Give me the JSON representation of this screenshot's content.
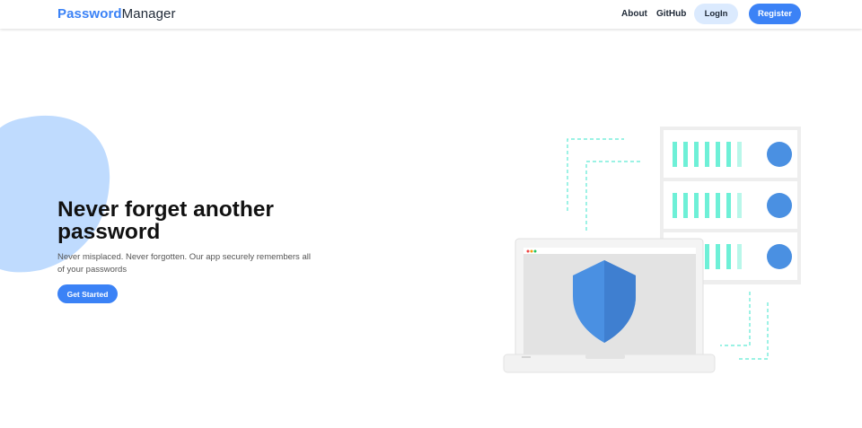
{
  "nav": {
    "brand_primary": "Password",
    "brand_secondary": "Manager",
    "links": [
      "About",
      "GitHub"
    ],
    "login_label": "LogIn",
    "register_label": "Register"
  },
  "hero": {
    "title": "Never forget another password",
    "subtitle": "Never misplaced. Never forgotten. Our app securely remembers all of your passwords",
    "cta_label": "Get Started"
  },
  "colors": {
    "accent": "#3b82f6",
    "accent_light": "#dbeafe",
    "blob": "#bfdbfe",
    "teal": "#5eead4",
    "server_dot": "#4a90e2",
    "shield": "#4a90e2"
  },
  "illustration": {
    "icons": [
      "shield-icon",
      "laptop-icon",
      "server-icon"
    ]
  }
}
